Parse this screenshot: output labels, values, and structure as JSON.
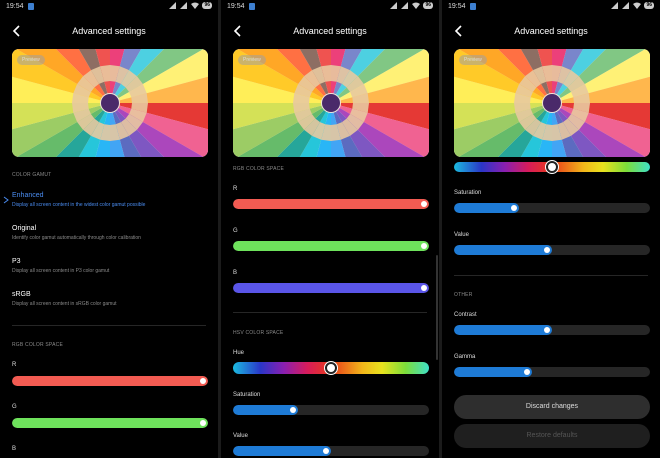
{
  "status": {
    "time": "19:54",
    "battery": "96"
  },
  "app": {
    "title": "Advanced settings",
    "preview_label": "Preview"
  },
  "sections": {
    "color_gamut": "COLOR GAMUT",
    "rgb": "RGB COLOR SPACE",
    "hsv": "HSV COLOR SPACE",
    "other": "OTHER"
  },
  "gamut_options": [
    {
      "title": "Enhanced",
      "desc": "Display all screen content in the widest color gamut possible",
      "selected": true
    },
    {
      "title": "Original",
      "desc": "Identify color gamut automatically through color calibration",
      "selected": false
    },
    {
      "title": "P3",
      "desc": "Display all screen content in P3 color gamut",
      "selected": false
    },
    {
      "title": "sRGB",
      "desc": "Display all screen content in sRGB color gamut",
      "selected": false
    }
  ],
  "sliders": {
    "r": {
      "label": "R",
      "value": 1.0,
      "color": "#f25b52"
    },
    "g": {
      "label": "G",
      "value": 1.0,
      "color": "#6ee25c"
    },
    "b": {
      "label": "B",
      "value": 1.0,
      "color": "#5a55e8"
    },
    "hue": {
      "label": "Hue",
      "value": 0.5
    },
    "saturation": {
      "label": "Saturation",
      "value": 0.33,
      "color": "#1e7bd6"
    },
    "value": {
      "label": "Value",
      "value": 0.5,
      "color": "#1e7bd6"
    },
    "contrast": {
      "label": "Contrast",
      "value": 0.5,
      "color": "#1e7bd6"
    },
    "gamma": {
      "label": "Gamma",
      "value": 0.4,
      "color": "#1e7bd6"
    }
  },
  "buttons": {
    "discard": "Discard changes",
    "restore": "Restore defaults"
  }
}
